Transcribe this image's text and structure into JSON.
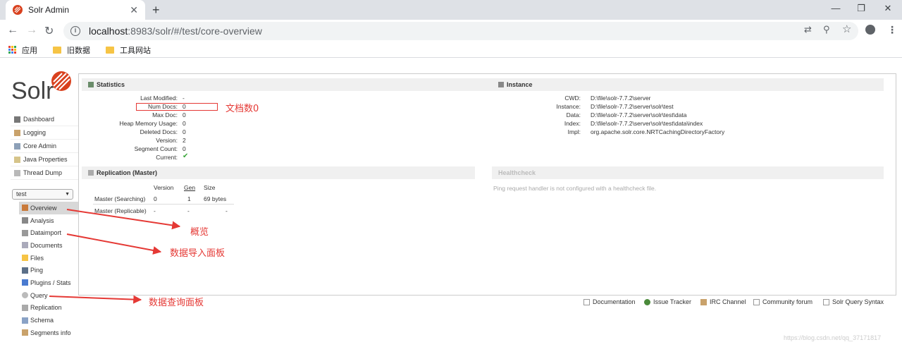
{
  "browser": {
    "tab_title": "Solr Admin",
    "tab_close": "✕",
    "new_tab": "+",
    "win_min": "—",
    "win_max": "❐",
    "win_close": "✕",
    "back": "←",
    "forward": "→",
    "reload": "↻",
    "url_host": "localhost",
    "url_rest": ":8983/solr/#/test/core-overview",
    "translate": "⇄",
    "zoom": "⚲",
    "star": "☆",
    "menu": "⋮",
    "bookmarks": [
      {
        "label": "应用"
      },
      {
        "label": "旧数据"
      },
      {
        "label": "工具网站"
      }
    ],
    "apps_colors": [
      "#ea4335",
      "#fbbc05",
      "#34a853",
      "#4285f4",
      "#ea4335",
      "#fbbc05",
      "#34a853",
      "#4285f4",
      "#ea4335"
    ],
    "folder_color": "#f6c445"
  },
  "solr": {
    "logo_text": "Solr",
    "logo_color": "#d9411e",
    "nav": [
      {
        "label": "Dashboard",
        "icon": "dashboard-icon"
      },
      {
        "label": "Logging",
        "icon": "logging-icon"
      },
      {
        "label": "Core Admin",
        "icon": "core-admin-icon"
      },
      {
        "label": "Java Properties",
        "icon": "java-properties-icon"
      },
      {
        "label": "Thread Dump",
        "icon": "thread-dump-icon"
      }
    ],
    "core_selected": "test",
    "core_menu": [
      {
        "label": "Overview",
        "icon": "home-icon",
        "active": true
      },
      {
        "label": "Analysis",
        "icon": "analysis-icon"
      },
      {
        "label": "Dataimport",
        "icon": "dataimport-icon"
      },
      {
        "label": "Documents",
        "icon": "documents-icon"
      },
      {
        "label": "Files",
        "icon": "files-icon"
      },
      {
        "label": "Ping",
        "icon": "ping-icon"
      },
      {
        "label": "Plugins / Stats",
        "icon": "plugins-icon"
      },
      {
        "label": "Query",
        "icon": "query-icon"
      },
      {
        "label": "Replication",
        "icon": "replication-icon"
      },
      {
        "label": "Schema",
        "icon": "schema-icon"
      },
      {
        "label": "Segments info",
        "icon": "segments-icon"
      }
    ],
    "statistics": {
      "title": "Statistics",
      "rows": [
        {
          "label": "Last Modified:",
          "value": "-"
        },
        {
          "label": "Num Docs:",
          "value": "0"
        },
        {
          "label": "Max Doc:",
          "value": "0"
        },
        {
          "label": "Heap Memory Usage:",
          "value": "0"
        },
        {
          "label": "Deleted Docs:",
          "value": "0"
        },
        {
          "label": "Version:",
          "value": "2"
        },
        {
          "label": "Segment Count:",
          "value": "0"
        },
        {
          "label": "Current:",
          "value": "✔"
        }
      ]
    },
    "instance": {
      "title": "Instance",
      "rows": [
        {
          "label": "CWD:",
          "value": "D:\\file\\solr-7.7.2\\server"
        },
        {
          "label": "Instance:",
          "value": "D:\\file\\solr-7.7.2\\server\\solr\\test"
        },
        {
          "label": "Data:",
          "value": "D:\\file\\solr-7.7.2\\server\\solr\\test\\data"
        },
        {
          "label": "Index:",
          "value": "D:\\file\\solr-7.7.2\\server\\solr\\test\\data\\index"
        },
        {
          "label": "Impl:",
          "value": "org.apache.solr.core.NRTCachingDirectoryFactory"
        }
      ]
    },
    "replication": {
      "title": "Replication (Master)",
      "headers": [
        "Version",
        "Gen",
        "Size"
      ],
      "rows": [
        {
          "name": "Master (Searching)",
          "version": "0",
          "gen": "1",
          "size": "69 bytes"
        },
        {
          "name": "Master (Replicable)",
          "version": "-",
          "gen": "-",
          "size": "-"
        }
      ]
    },
    "healthcheck": {
      "title": "Healthcheck",
      "message": "Ping request handler is not configured with a healthcheck file."
    },
    "footer": [
      {
        "label": "Documentation",
        "icon": "documentation-icon"
      },
      {
        "label": "Issue Tracker",
        "icon": "issue-tracker-icon"
      },
      {
        "label": "IRC Channel",
        "icon": "irc-channel-icon"
      },
      {
        "label": "Community forum",
        "icon": "community-forum-icon"
      },
      {
        "label": "Solr Query Syntax",
        "icon": "query-syntax-icon"
      }
    ]
  },
  "annotations": {
    "num_docs": "文档数0",
    "overview": "概览",
    "dataimport": "数据导入面板",
    "query": "数据查询面板",
    "color": "#e53935"
  },
  "watermark": "https://blog.csdn.net/qq_37171817"
}
